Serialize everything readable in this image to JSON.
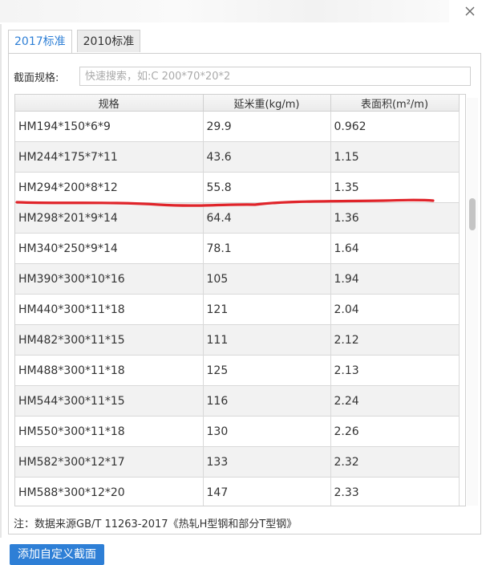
{
  "tabs": [
    {
      "label": "2017标准",
      "active": true
    },
    {
      "label": "2010标准",
      "active": false
    }
  ],
  "search": {
    "label": "截面规格:",
    "value": "",
    "placeholder": "快速搜索，如:C 200*70*20*2"
  },
  "table": {
    "headers": [
      "规格",
      "延米重(kg/m)",
      "表面积(m²/m)"
    ],
    "rows": [
      [
        "HM194*150*6*9",
        "29.9",
        "0.962"
      ],
      [
        "HM244*175*7*11",
        "43.6",
        "1.15"
      ],
      [
        "HM294*200*8*12",
        "55.8",
        "1.35"
      ],
      [
        "HM298*201*9*14",
        "64.4",
        "1.36"
      ],
      [
        "HM340*250*9*14",
        "78.1",
        "1.64"
      ],
      [
        "HM390*300*10*16",
        "105",
        "1.94"
      ],
      [
        "HM440*300*11*18",
        "121",
        "2.04"
      ],
      [
        "HM482*300*11*15",
        "111",
        "2.12"
      ],
      [
        "HM488*300*11*18",
        "125",
        "2.13"
      ],
      [
        "HM544*300*11*15",
        "116",
        "2.24"
      ],
      [
        "HM550*300*11*18",
        "130",
        "2.26"
      ],
      [
        "HM582*300*12*17",
        "133",
        "2.32"
      ],
      [
        "HM588*300*12*20",
        "147",
        "2.33"
      ]
    ]
  },
  "note": "注：数据来源GB/T 11263-2017《热轧H型钢和部分T型钢》",
  "add_button_label": "添加自定义截面",
  "colors": {
    "accent": "#2e7fd6",
    "annotation": "#e0242a"
  },
  "icons": {
    "close": "close-icon"
  }
}
